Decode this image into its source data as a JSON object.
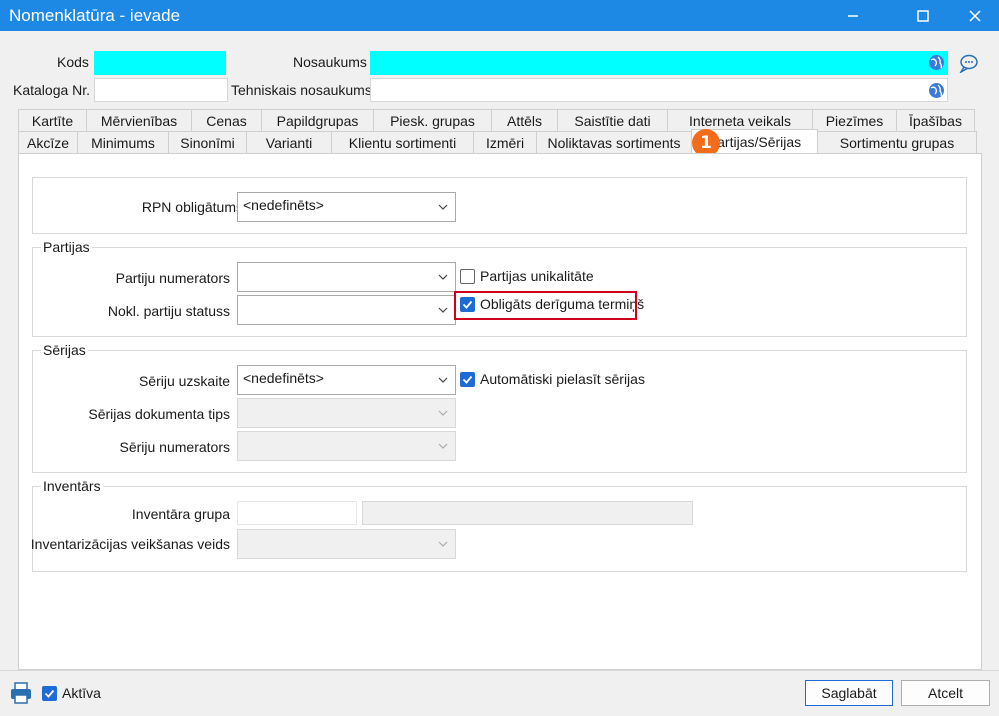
{
  "window": {
    "title": "Nomenklatūra - ievade",
    "minimize_icon": "minimize-icon",
    "maximize_icon": "maximize-icon",
    "close_icon": "close-icon"
  },
  "header": {
    "kods_label": "Kods",
    "kods_value": "",
    "nosaukums_label": "Nosaukums",
    "nosaukums_value": "",
    "kataloga_label": "Kataloga Nr.",
    "kataloga_value": "",
    "tehniskais_label": "Tehniskais nosaukums",
    "tehniskais_value": "",
    "highlight_color": "#00ffff"
  },
  "tabs_row1": [
    "Kartīte",
    "Mērvienības",
    "Cenas",
    "Papildgrupas",
    "Piesk. grupas",
    "Attēls",
    "Saistītie dati",
    "Interneta veikals",
    "Piezīmes",
    "Īpašības"
  ],
  "tabs_row2": [
    "Akcīze",
    "Minimums",
    "Sinonīmi",
    "Varianti",
    "Klientu sortimenti",
    "Izmēri",
    "Noliktavas sortiments",
    "Partijas/Sērijas",
    "Sortimentu grupas"
  ],
  "badge": "1",
  "rpn": {
    "label": "RPN obligātums",
    "value": "<nedefinēts>"
  },
  "partijas": {
    "title": "Partijas",
    "numerators_label": "Partiju numerators",
    "numerators_value": "",
    "statuss_label": "Nokl. partiju statuss",
    "statuss_value": "",
    "unikalitate_label": "Partijas unikalitāte",
    "unikalitate_checked": false,
    "deriguma_label": "Obligāts derīguma termiņš",
    "deriguma_checked": true
  },
  "serijas": {
    "title": "Sērijas",
    "uzskaite_label": "Sēriju uzskaite",
    "uzskaite_value": "<nedefinēts>",
    "automatiski_label": "Automātiski pielasīt sērijas",
    "automatiski_checked": true,
    "dok_tips_label": "Sērijas dokumenta tips",
    "numerators_label": "Sēriju numerators"
  },
  "inventars": {
    "title": "Inventārs",
    "grupa_label": "Inventāra grupa",
    "veids_label": "Inventarizācijas veikšanas veids"
  },
  "footer": {
    "aktiva_label": "Aktīva",
    "aktiva_checked": true,
    "save_label": "Saglabāt",
    "cancel_label": "Atcelt"
  },
  "colors": {
    "titlebar": "#1e88e5",
    "checkbox": "#1e6bd6",
    "highlight_border": "#d0021b",
    "badge": "#f26c1a"
  }
}
